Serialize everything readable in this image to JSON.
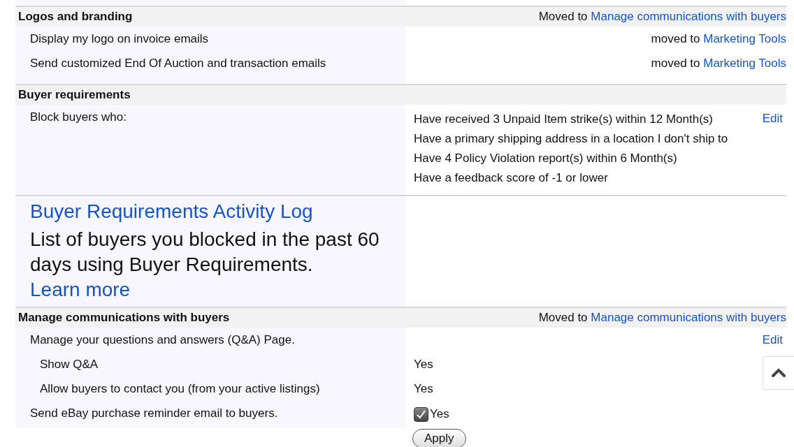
{
  "sections": [
    {
      "kind": "settings",
      "title": "Logos and branding",
      "moved_prefix": "Moved to",
      "moved_link": "Manage communications with buyers",
      "rows": [
        {
          "label": "Display my logo on invoice emails",
          "value_prefix": "moved to",
          "value_link": "Marketing Tools"
        },
        {
          "label": "Send customized End Of Auction and transaction emails",
          "value_prefix": "moved to",
          "value_link": "Marketing Tools"
        }
      ]
    },
    {
      "kind": "settings",
      "title": "Buyer requirements",
      "rows": [
        {
          "label": "Block buyers who:",
          "values": [
            "Have received 3 Unpaid Item strike(s) within 12 Month(s)",
            "Have a primary shipping address in a location I don't ship to",
            "Have 4 Policy Violation report(s) within 6 Month(s)",
            "Have a feedback score of -1 or lower"
          ],
          "action": "Edit"
        }
      ]
    },
    {
      "kind": "promo",
      "title": "Buyer Requirements Activity Log",
      "text": "List of buyers you blocked in the past 60 days using Buyer Requirements.",
      "link": "Learn more"
    },
    {
      "kind": "settings",
      "title": "Manage communications with buyers",
      "moved_prefix": "Moved to",
      "moved_link": "Manage communications with buyers",
      "rows": [
        {
          "label": "Manage your questions and answers (Q&A) Page.",
          "action": "Edit",
          "children": [
            {
              "label": "Show Q&A",
              "value": "Yes"
            },
            {
              "label": "Allow buyers to contact you (from your active listings)",
              "value": "Yes"
            }
          ]
        },
        {
          "label": "Send eBay purchase reminder email to buyers.",
          "checked": true,
          "value": "Yes"
        }
      ],
      "button": "Apply"
    }
  ]
}
